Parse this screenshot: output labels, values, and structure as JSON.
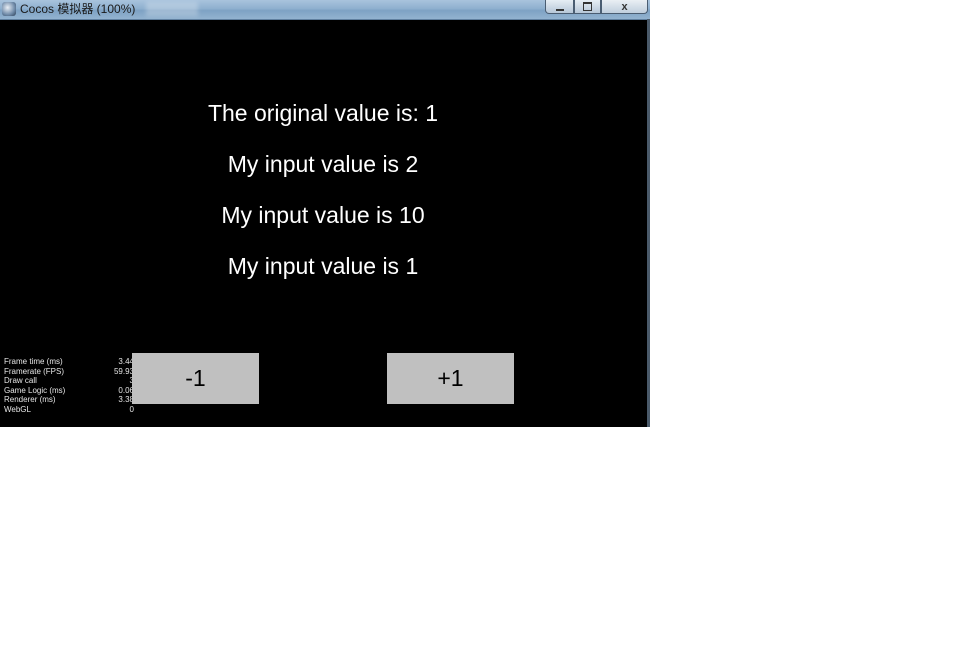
{
  "window": {
    "title": "Cocos 模拟器 (100%)",
    "controls": {
      "minimize_icon": "minimize-icon",
      "maximize_icon": "maximize-icon",
      "close_label": "x"
    }
  },
  "labels": {
    "original": "The original value is: 1",
    "inputs": [
      "My input value is 2",
      "My input value is 10",
      "My input value is 1"
    ]
  },
  "buttons": {
    "decrement_label": "-1",
    "increment_label": "+1",
    "color": "#c0c0c0"
  },
  "stats": [
    {
      "name": "Frame time (ms)",
      "value": "3.44"
    },
    {
      "name": "Framerate (FPS)",
      "value": "59.93"
    },
    {
      "name": "Draw call",
      "value": "3"
    },
    {
      "name": "Game Logic (ms)",
      "value": "0.06"
    },
    {
      "name": "Renderer (ms)",
      "value": "3.38"
    },
    {
      "name": "WebGL",
      "value": "0"
    }
  ]
}
